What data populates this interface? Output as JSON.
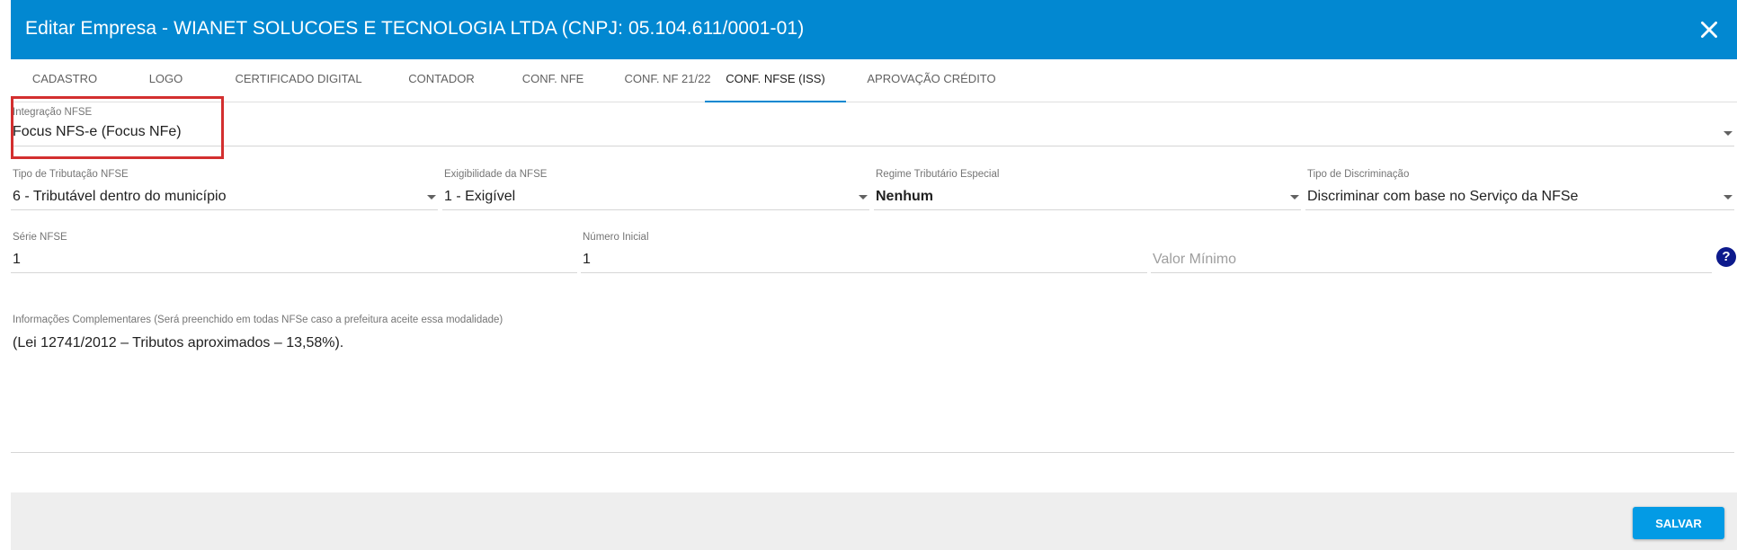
{
  "header": {
    "title": "Editar Empresa - WIANET SOLUCOES E TECNOLOGIA LTDA (CNPJ: 05.104.611/0001-01)",
    "background_color": "#0288d1",
    "close_icon": "close-icon"
  },
  "tabs": [
    {
      "label": "CADASTRO",
      "active": false
    },
    {
      "label": "LOGO",
      "active": false
    },
    {
      "label": "CERTIFICADO DIGITAL",
      "active": false
    },
    {
      "label": "CONTADOR",
      "active": false
    },
    {
      "label": "CONF. NFE",
      "active": false
    },
    {
      "label": "CONF. NF 21/22",
      "active": false
    },
    {
      "label": "CONF. NFSE (ISS)",
      "active": true
    },
    {
      "label": "APROVAÇÃO CRÉDITO",
      "active": false
    }
  ],
  "form": {
    "integracao": {
      "label": "Integração NFSE",
      "value": "Focus NFS-e (Focus NFe)"
    },
    "tipo_tributacao": {
      "label": "Tipo de Tributação NFSE",
      "value": "6 - Tributável dentro do município"
    },
    "exigibilidade": {
      "label": "Exigibilidade da NFSE",
      "value": "1 - Exigível"
    },
    "regime": {
      "label": "Regime Tributário Especial",
      "value": "Nenhum"
    },
    "discriminacao": {
      "label": "Tipo de Discriminação",
      "value": "Discriminar com base no Serviço da NFSe"
    },
    "serie": {
      "label": "Série NFSE",
      "value": "1"
    },
    "numero_inicial": {
      "label": "Número Inicial",
      "value": "1"
    },
    "valor_minimo": {
      "placeholder": "Valor Mínimo",
      "value": ""
    },
    "help": {
      "glyph": "?",
      "icon": "help-icon"
    },
    "informacoes": {
      "label": "Informações Complementares (Será preenchido em todas NFSe caso a prefeitura aceite essa modalidade)",
      "value": "(Lei 12741/2012 – Tributos aproximados – 13,58%)."
    }
  },
  "footer": {
    "save_label": "SALVAR",
    "save_color": "#039be5"
  },
  "highlight_color": "#d32f2f"
}
